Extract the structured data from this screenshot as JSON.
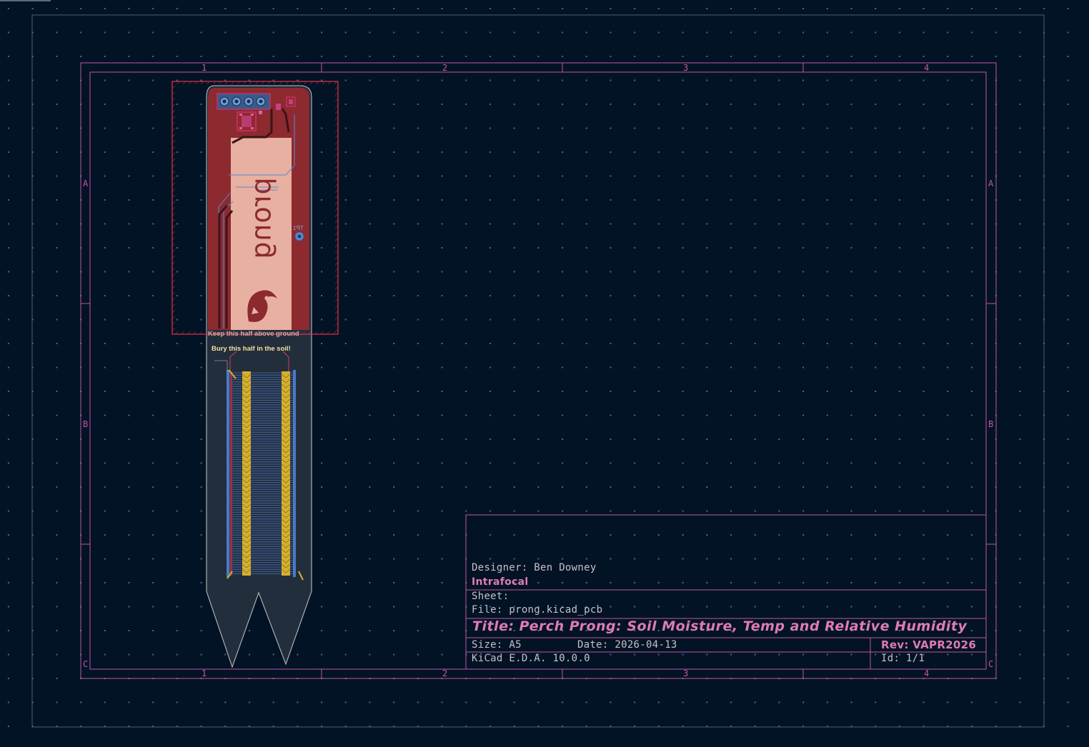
{
  "colors": {
    "background": "#011325",
    "grid_dot": "#5a6680",
    "frame": "#c455a8",
    "board_fill": "#232e3d",
    "copper_front": "#8c2a30",
    "copper_back": "#4a7ac8",
    "silk_pad": "#e8b0a0",
    "courtyard": "#e83070",
    "text_pink": "#e07ab8",
    "text_gray": "#c8c0c8",
    "yellow_trace": "#d4b030"
  },
  "zones": {
    "cols": [
      "1",
      "2",
      "3",
      "4"
    ],
    "rows": [
      "A",
      "B",
      "C"
    ]
  },
  "board": {
    "silk_logo_text": "prong",
    "silk_top_text": "Keep this half above ground",
    "silk_bottom_text": "Bury this half in the soil!",
    "ref_tp": "TP1"
  },
  "title_block": {
    "designer": "Designer: Ben Downey",
    "company": "Intrafocal",
    "sheet": "Sheet:",
    "file": "File: prong.kicad_pcb",
    "title": "Title: Perch Prong: Soil Moisture, Temp and Relative Humidity",
    "size": "Size: A5",
    "date": "Date: 2026-04-13",
    "tool": "KiCad E.D.A. 10.0.0",
    "rev": "Rev: VAPR2026",
    "id": "Id: 1/1"
  }
}
